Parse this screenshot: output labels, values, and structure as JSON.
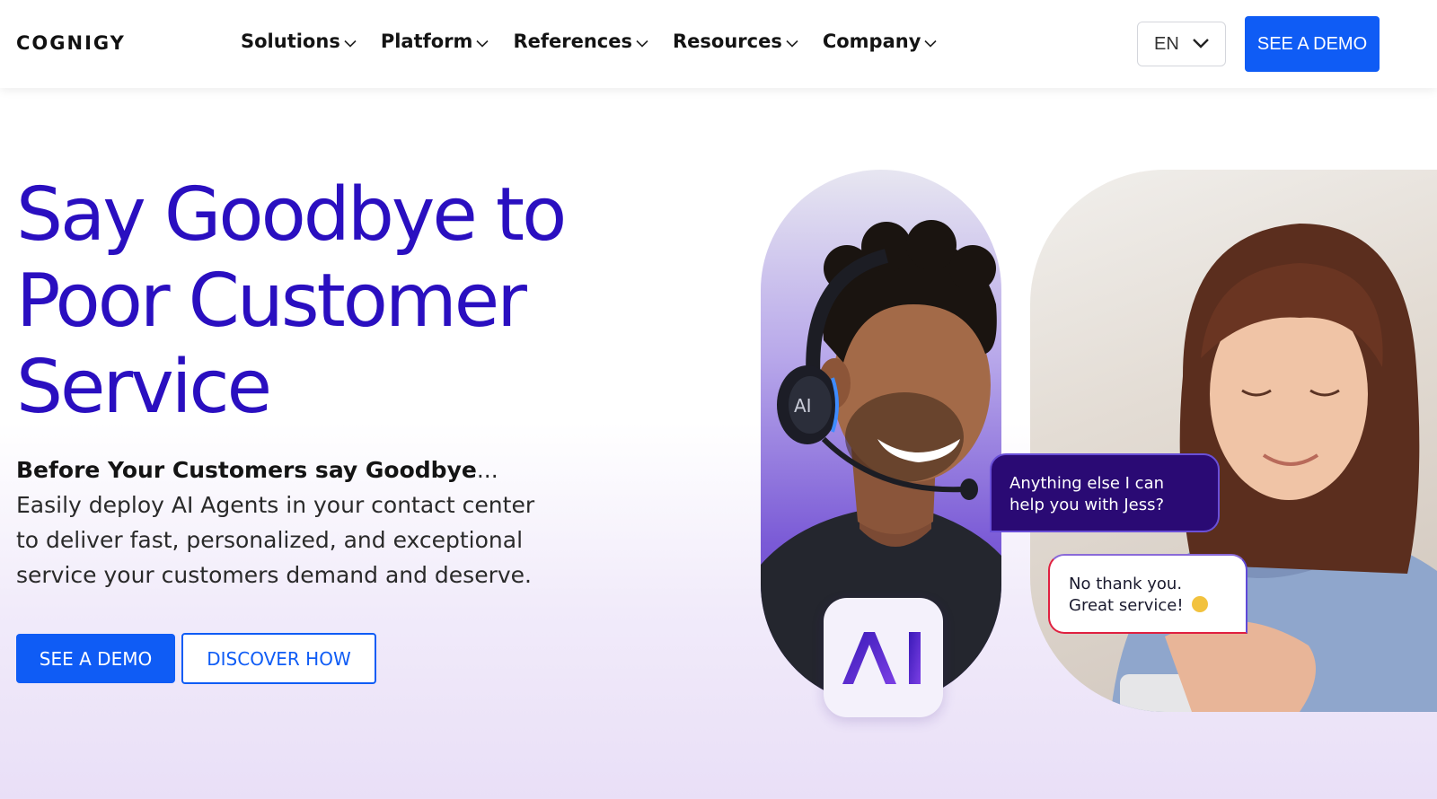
{
  "header": {
    "logo": "COGNIGY",
    "nav": [
      {
        "label": "Solutions"
      },
      {
        "label": "Platform"
      },
      {
        "label": "References"
      },
      {
        "label": "Resources"
      },
      {
        "label": "Company"
      }
    ],
    "language": "EN",
    "cta_label": "SEE A DEMO"
  },
  "hero": {
    "title_lines": [
      "Say Goodbye to",
      "Poor Customer",
      "Service"
    ],
    "desc_bold": "Before Your Customers say Goodbye",
    "desc_rest": "... Easily deploy AI Agents in your contact center to deliver fast, personalized, and exceptional service your customers demand and deserve.",
    "primary_label": "SEE A DEMO",
    "secondary_label": "DISCOVER HOW"
  },
  "visual": {
    "badge_text": "AI",
    "headset_text": "AI",
    "ai_bubble": "Anything else I can help you with Jess?",
    "user_bubble": "No thank you. Great service!"
  },
  "colors": {
    "primary": "#0f5cf5",
    "title": "#2a0fc0",
    "ai_bubble_bg": "#2a0a74"
  }
}
